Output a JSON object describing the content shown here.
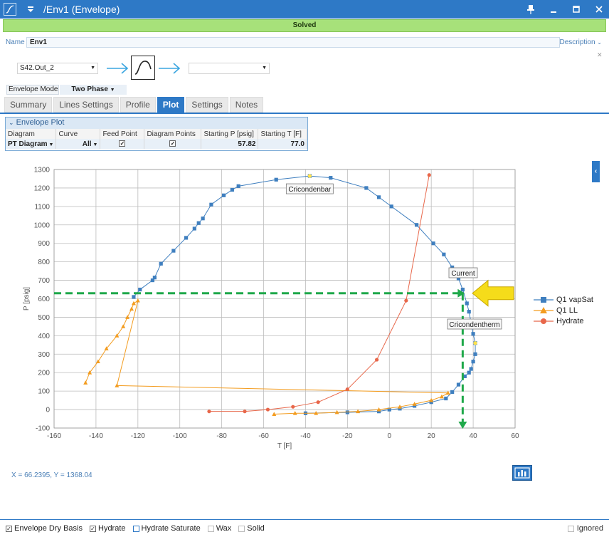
{
  "window": {
    "title": "/Env1 (Envelope)"
  },
  "status": {
    "text": "Solved"
  },
  "name_row": {
    "label": "Name",
    "value": "Env1",
    "description_link": "Description"
  },
  "streams": {
    "inlet": "S42.Out_2",
    "outlet": ""
  },
  "envelope_mode": {
    "label": "Envelope Mode",
    "value": "Two Phase"
  },
  "tabs": [
    {
      "label": "Summary"
    },
    {
      "label": "Lines Settings"
    },
    {
      "label": "Profile"
    },
    {
      "label": "Plot"
    },
    {
      "label": "Settings"
    },
    {
      "label": "Notes"
    }
  ],
  "active_tab": "Plot",
  "envelope_plot": {
    "title": "Envelope Plot",
    "headers": [
      "Diagram",
      "Curve",
      "Feed Point",
      "Diagram Points",
      "Starting P [psig]",
      "Starting T [F]"
    ],
    "values": {
      "diagram": "PT Diagram",
      "curve": "All",
      "feed_point": true,
      "diagram_points": true,
      "starting_p": "57.82",
      "starting_t": "77.0"
    }
  },
  "colors": {
    "accent": "#2e79c6",
    "vapsat": "#3f7fbf",
    "ll": "#f39c1f",
    "hydrate": "#e8674a",
    "guide": "#1fa84a",
    "arrow": "#f5dc1a"
  },
  "chart_data": {
    "type": "scatter",
    "xlabel": "T [F]",
    "ylabel": "P [psig]",
    "xlim": [
      -160,
      60
    ],
    "ylim": [
      -100,
      1300
    ],
    "xticks": [
      -160,
      -140,
      -120,
      -100,
      -80,
      -60,
      -40,
      -20,
      0,
      20,
      40,
      60
    ],
    "yticks": [
      -100,
      0,
      100,
      200,
      300,
      400,
      500,
      600,
      700,
      800,
      900,
      1000,
      1100,
      1200,
      1300
    ],
    "grid": true,
    "legend_position": "right",
    "series": [
      {
        "name": "Q1 vapSat",
        "marker": "square",
        "x": [
          -122,
          -119,
          -113,
          -112,
          -109,
          -103,
          -97,
          -93,
          -91,
          -89,
          -85,
          -79,
          -75,
          -72,
          -54,
          -38,
          -28,
          -11,
          -5,
          1,
          13,
          21,
          26,
          30,
          33,
          35,
          37,
          38,
          39,
          40,
          41,
          41,
          40,
          39,
          38,
          36,
          33,
          30,
          27,
          20,
          12,
          5,
          0,
          -5,
          -20,
          -40
        ],
        "y": [
          610,
          650,
          700,
          715,
          790,
          860,
          930,
          980,
          1010,
          1035,
          1110,
          1160,
          1190,
          1210,
          1245,
          1265,
          1255,
          1200,
          1150,
          1100,
          1000,
          900,
          840,
          770,
          710,
          650,
          575,
          530,
          470,
          410,
          360,
          300,
          260,
          220,
          200,
          180,
          135,
          95,
          60,
          40,
          20,
          5,
          0,
          -10,
          -15,
          -20
        ]
      },
      {
        "name": "Q1 LL",
        "marker": "triangle",
        "x": [
          -145,
          -143,
          -139,
          -135,
          -130,
          -127,
          -125,
          -123,
          -122,
          -120,
          -130,
          28,
          25,
          20,
          12,
          5,
          -5,
          -15,
          -25,
          -35,
          -45,
          -55
        ],
        "y": [
          145,
          200,
          260,
          330,
          400,
          450,
          500,
          545,
          575,
          590,
          130,
          90,
          70,
          50,
          30,
          15,
          0,
          -10,
          -15,
          -20,
          -20,
          -25
        ]
      },
      {
        "name": "Hydrate",
        "marker": "circle",
        "x": [
          -86,
          -69,
          -58,
          -46,
          -34,
          -20,
          -6,
          8,
          19
        ],
        "y": [
          -10,
          -10,
          0,
          15,
          40,
          110,
          270,
          590,
          1270
        ]
      }
    ],
    "annotations": [
      {
        "text": "Cricondenbar",
        "x": -38,
        "y": 1265
      },
      {
        "text": "Current",
        "x": 35,
        "y": 630
      },
      {
        "text": "Cricondentherm",
        "x": 41,
        "y": 360
      }
    ],
    "guide_lines": {
      "current_t": 35,
      "current_p": 630
    }
  },
  "coords_text": "X = 66.2395, Y = 1368.04",
  "footer": {
    "items": [
      {
        "label": "Envelope Dry Basis",
        "checked": true
      },
      {
        "label": "Hydrate",
        "checked": true
      },
      {
        "label": "Hydrate Saturate",
        "checked": false
      },
      {
        "label": "Wax",
        "checked": false
      },
      {
        "label": "Solid",
        "checked": false
      }
    ],
    "ignored_label": "Ignored"
  }
}
